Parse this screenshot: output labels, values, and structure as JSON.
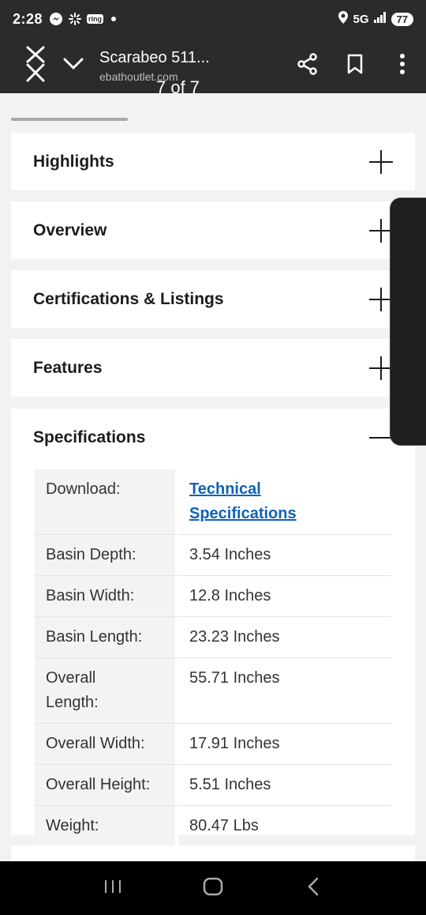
{
  "status": {
    "time": "2:28",
    "ring_label": "ring",
    "network": "5G",
    "battery": "77"
  },
  "toolbar": {
    "title": "Scarabeo 511...",
    "url": "ebathoutlet.com",
    "page_counter": "7 of 7"
  },
  "sections": [
    {
      "title": "Highlights",
      "expanded": false
    },
    {
      "title": "Overview",
      "expanded": false
    },
    {
      "title": "Certifications & Listings",
      "expanded": false
    },
    {
      "title": "Features",
      "expanded": false
    },
    {
      "title": "Specifications",
      "expanded": true
    }
  ],
  "specifications": {
    "download_label": "Download:",
    "download_link_line1": "Technical",
    "download_link_line2": "Specifications",
    "rows": [
      {
        "label": "Basin Depth:",
        "value": "3.54 Inches"
      },
      {
        "label": "Basin Width:",
        "value": "12.8 Inches"
      },
      {
        "label": "Basin Length:",
        "value": "23.23 Inches"
      },
      {
        "label_line1": "Overall",
        "label_line2": "Length:",
        "value": "55.71 Inches"
      },
      {
        "label": "Overall Width:",
        "value": "17.91 Inches"
      },
      {
        "label": "Overall Height:",
        "value": "5.51 Inches"
      },
      {
        "label": "Weight:",
        "value": "80.47 Lbs"
      }
    ]
  },
  "icons": {
    "close": "close-icon",
    "chevron": "chevron-down-icon",
    "share": "share-icon",
    "bookmark": "bookmark-icon",
    "more": "more-vertical-icon"
  }
}
